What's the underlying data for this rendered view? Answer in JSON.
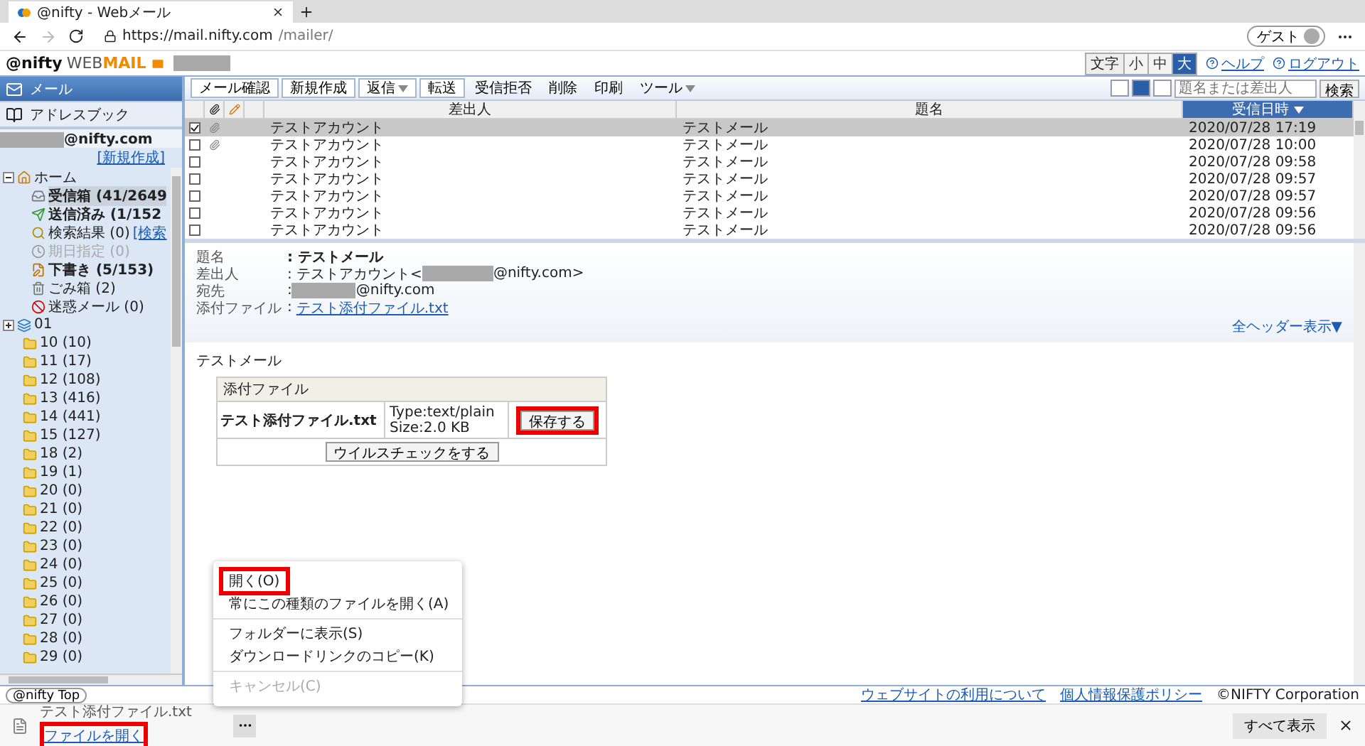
{
  "browser": {
    "tab": {
      "title": "@nifty - Webメール"
    },
    "url": {
      "host": "https://mail.nifty.com",
      "path": "/mailer/"
    },
    "profile": "ゲスト"
  },
  "header": {
    "logo": {
      "brand": "@nifty",
      "web": "WEB",
      "mail": "MAIL"
    },
    "font_size": {
      "label": "文字",
      "options": [
        {
          "label": "小",
          "selected": false
        },
        {
          "label": "中",
          "selected": false
        },
        {
          "label": "大",
          "selected": true
        }
      ]
    },
    "links": [
      "ヘルプ",
      "ログアウト"
    ]
  },
  "sidebar": {
    "nav": [
      {
        "label": "メール",
        "selected": true
      },
      {
        "label": "アドレスブック",
        "selected": false
      }
    ],
    "account": "@nifty.com",
    "new_link": "[新規作成]",
    "tree": [
      {
        "label": "ホーム",
        "kind": "home",
        "expanded": true,
        "children": [
          {
            "label": "受信箱 (41/2649",
            "kind": "inbox",
            "unread": true,
            "selected": true,
            "disabled": false
          },
          {
            "label": "送信済み (1/152",
            "kind": "sent",
            "unread": true,
            "selected": false,
            "disabled": false
          },
          {
            "label": "検索結果 (0)",
            "link": "[検索",
            "kind": "search",
            "unread": false,
            "selected": false,
            "disabled": false
          },
          {
            "label": "期日指定 (0)",
            "kind": "scheduled",
            "unread": false,
            "selected": false,
            "disabled": true
          },
          {
            "label": "下書き (5/153)",
            "kind": "draft",
            "unread": true,
            "selected": false,
            "disabled": false
          },
          {
            "label": "ごみ箱 (2)",
            "kind": "trash",
            "unread": false,
            "selected": false,
            "disabled": false
          },
          {
            "label": "迷惑メール (0)",
            "kind": "spam",
            "unread": false,
            "selected": false,
            "disabled": false
          }
        ]
      },
      {
        "label": "01",
        "kind": "group",
        "expanded": false
      },
      {
        "label": "10 (10)",
        "kind": "folder"
      },
      {
        "label": "11 (17)",
        "kind": "folder"
      },
      {
        "label": "12 (108)",
        "kind": "folder"
      },
      {
        "label": "13 (416)",
        "kind": "folder"
      },
      {
        "label": "14 (441)",
        "kind": "folder"
      },
      {
        "label": "15 (127)",
        "kind": "folder"
      },
      {
        "label": "18 (2)",
        "kind": "folder"
      },
      {
        "label": "19 (1)",
        "kind": "folder"
      },
      {
        "label": "20 (0)",
        "kind": "folder"
      },
      {
        "label": "21 (0)",
        "kind": "folder"
      },
      {
        "label": "22 (0)",
        "kind": "folder"
      },
      {
        "label": "23 (0)",
        "kind": "folder"
      },
      {
        "label": "24 (0)",
        "kind": "folder"
      },
      {
        "label": "25 (0)",
        "kind": "folder"
      },
      {
        "label": "26 (0)",
        "kind": "folder"
      },
      {
        "label": "27 (0)",
        "kind": "folder"
      },
      {
        "label": "28 (0)",
        "kind": "folder"
      },
      {
        "label": "29 (0)",
        "kind": "folder"
      }
    ]
  },
  "toolbar": {
    "buttons": [
      {
        "label": "メール確認",
        "kind": "button"
      },
      {
        "label": "新規作成",
        "kind": "button"
      },
      {
        "label": "返信",
        "kind": "split"
      },
      {
        "label": "転送",
        "kind": "button"
      },
      {
        "label": "受信拒否",
        "kind": "plain"
      },
      {
        "label": "削除",
        "kind": "plain"
      },
      {
        "label": "印刷",
        "kind": "plain"
      },
      {
        "label": "ツール",
        "kind": "menu"
      }
    ],
    "views": [
      {
        "selected": false
      },
      {
        "selected": true
      },
      {
        "selected": false
      }
    ],
    "search": {
      "placeholder": "題名または差出人",
      "button": "検索"
    }
  },
  "message_list": {
    "columns": [
      {
        "label": "差出人",
        "sorted": false
      },
      {
        "label": "題名",
        "sorted": false
      },
      {
        "label": "受信日時",
        "sorted": true
      }
    ],
    "rows": [
      {
        "sender": "テストアカウント",
        "subject": "テストメール",
        "date": "2020/07/28 17:19",
        "checked": true,
        "selected": true,
        "attachment": true
      },
      {
        "sender": "テストアカウント",
        "subject": "テストメール",
        "date": "2020/07/28 10:00",
        "checked": false,
        "selected": false,
        "attachment": true
      },
      {
        "sender": "テストアカウント",
        "subject": "テストメール",
        "date": "2020/07/28 09:58",
        "checked": false,
        "selected": false,
        "attachment": false
      },
      {
        "sender": "テストアカウント",
        "subject": "テストメール",
        "date": "2020/07/28 09:57",
        "checked": false,
        "selected": false,
        "attachment": false
      },
      {
        "sender": "テストアカウント",
        "subject": "テストメール",
        "date": "2020/07/28 09:57",
        "checked": false,
        "selected": false,
        "attachment": false
      },
      {
        "sender": "テストアカウント",
        "subject": "テストメール",
        "date": "2020/07/28 09:56",
        "checked": false,
        "selected": false,
        "attachment": false
      },
      {
        "sender": "テストアカウント",
        "subject": "テストメール",
        "date": "2020/07/28 09:56",
        "checked": false,
        "selected": false,
        "attachment": false
      }
    ]
  },
  "preview": {
    "fields": [
      {
        "label": "題名",
        "value": ": テストメール",
        "kind": "bold"
      },
      {
        "label": "差出人",
        "value": ": テストアカウント<",
        "suffix": "@nifty.com>",
        "kind": "redacted"
      },
      {
        "label": "宛先",
        "value": ":",
        "suffix": "@nifty.com",
        "kind": "redacted"
      },
      {
        "label": "添付ファイル",
        "value": ":",
        "link": "テスト添付ファイル.txt",
        "kind": "link"
      }
    ],
    "full_header_link": "全ヘッダー表示▼",
    "body": "テストメール",
    "attachment": {
      "title": "添付ファイル",
      "name": "テスト添付ファイル.txt",
      "type": "Type:text/plain",
      "size": "Size:2.0 KB",
      "save": "保存する",
      "save_highlighted": true,
      "virus_check": "ウイルスチェックをする"
    }
  },
  "footer": {
    "top_button": "@nifty Top",
    "links": [
      "ウェブサイトの利用について",
      "個人情報保護ポリシー"
    ],
    "copyright": "©NIFTY Corporation"
  },
  "download_bar": {
    "file": "テスト添付ファイル.txt",
    "open_link": "ファイルを開く",
    "open_highlighted": true,
    "show_all": "すべて表示"
  },
  "context_menu": {
    "groups": [
      [
        {
          "label": "開く(O)",
          "disabled": false,
          "highlighted": true
        },
        {
          "label": "常にこの種類のファイルを開く(A)",
          "disabled": false,
          "highlighted": false
        }
      ],
      [
        {
          "label": "フォルダーに表示(S)",
          "disabled": false,
          "highlighted": false
        },
        {
          "label": "ダウンロードリンクのコピー(K)",
          "disabled": false,
          "highlighted": false
        }
      ],
      [
        {
          "label": "キャンセル(C)",
          "disabled": true,
          "highlighted": false
        }
      ]
    ]
  }
}
